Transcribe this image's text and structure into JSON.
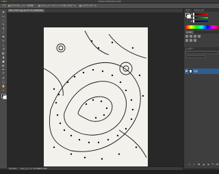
{
  "app": {
    "window_title": "Adobe Photoshop CS6"
  },
  "options_bar": {
    "tool_icon": "rectangle-marquee-icon",
    "checkbox1_label": "すべてのレイヤーを対象",
    "checkbox2_label": "ドキュメントウィンドウをスクロール",
    "extra_label": "スクラブズーム"
  },
  "document": {
    "tab_label": "IMG_2341.jpg @ 33.3% (RGB/8#)",
    "zoom": "33.33%",
    "status_text": "ドキュメント: 8.43M/8.43M"
  },
  "panels": {
    "color_panel_tab1": "カラー",
    "color_panel_tab2": "スウォッチ",
    "channels": [
      "R",
      "G",
      "B"
    ],
    "adjust_panel_tab": "色調補正",
    "layers_panel_tab": "レイヤー",
    "layer_name": "背景"
  },
  "colors": {
    "ui_dark": "#2b2b2b",
    "panel": "#3e3e3e",
    "selected_layer": "#2f5f8f",
    "canvas_paper": "#f2f1ec"
  },
  "chart_data": []
}
